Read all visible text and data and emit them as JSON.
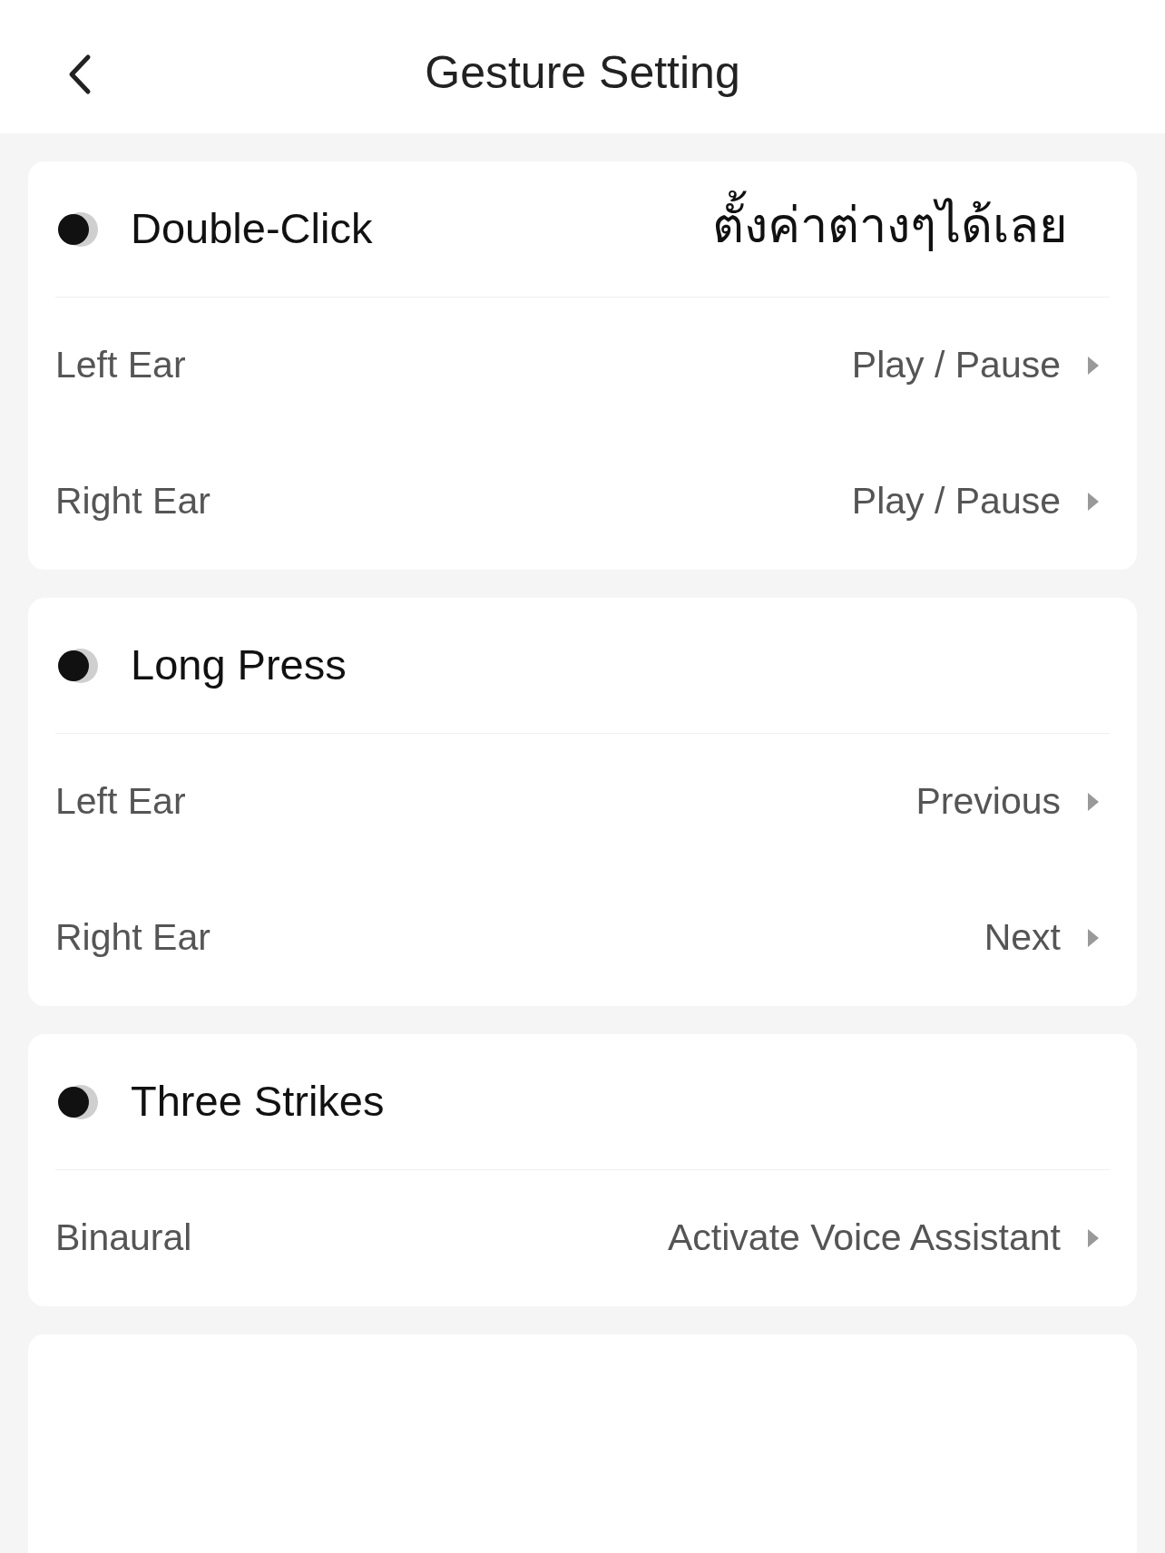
{
  "header": {
    "title": "Gesture Setting"
  },
  "caption": "ตั้งค่าต่างๆได้เลย",
  "sections": [
    {
      "title": "Double-Click",
      "rows": [
        {
          "label": "Left Ear",
          "value": "Play / Pause"
        },
        {
          "label": "Right Ear",
          "value": "Play / Pause"
        }
      ]
    },
    {
      "title": "Long Press",
      "rows": [
        {
          "label": "Left Ear",
          "value": "Previous"
        },
        {
          "label": "Right Ear",
          "value": "Next"
        }
      ]
    },
    {
      "title": "Three Strikes",
      "rows": [
        {
          "label": "Binaural",
          "value": "Activate Voice Assistant"
        }
      ]
    }
  ]
}
